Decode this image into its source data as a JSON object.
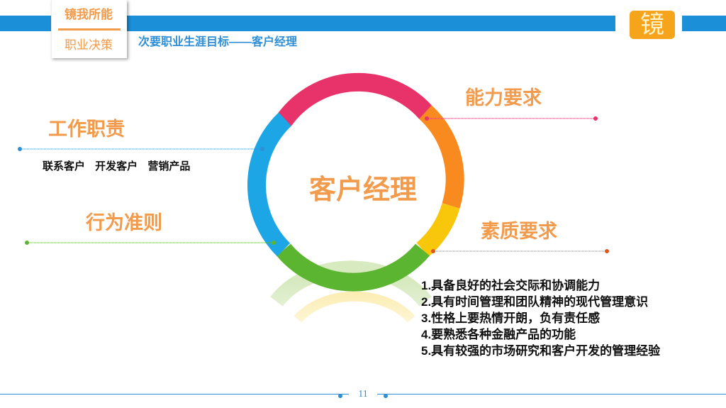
{
  "header": {
    "tab_title": "镜我所能",
    "tab_subtitle": "职业决策",
    "slide_subtitle": "次要职业生涯目标——客户经理",
    "logo_char": "镜"
  },
  "center": {
    "title": "客户经理"
  },
  "sections": {
    "duties": {
      "title": "工作职责",
      "items": "联系客户   开发客户   营销产品"
    },
    "conduct": {
      "title": "行为准则"
    },
    "ability": {
      "title": "能力要求"
    },
    "quality": {
      "title": "素质要求",
      "items": [
        "1.具备良好的社会交际和协调能力",
        "2.具有时间管理和团队精神的现代管理意识",
        "3.性格上要热情开朗，负有责任感",
        "4.要熟悉各种金融产品的功能",
        "5.具有较强的市场研究和客户开发的管理经验"
      ]
    }
  },
  "footer": {
    "page_number": "11"
  },
  "colors": {
    "accent": "#f29b4c",
    "brand_blue": "#1b8fd8",
    "logo_bg": "#f7a41d"
  }
}
